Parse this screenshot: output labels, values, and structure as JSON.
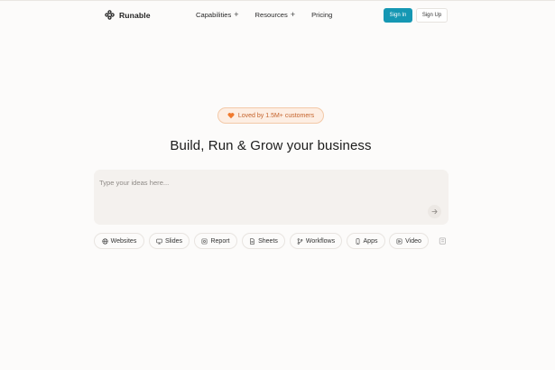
{
  "header": {
    "logo_text": "Runable",
    "nav": [
      {
        "label": "Capabilities",
        "icon": "plus-icon"
      },
      {
        "label": "Resources",
        "icon": "plus-icon"
      },
      {
        "label": "Pricing"
      }
    ],
    "sign_in_label": "Sign In",
    "sign_up_label": "Sign Up"
  },
  "hero": {
    "badge_text": "Loved by 1.5M+ customers",
    "badge_icon": "heart-icon",
    "title": "Build, Run & Grow your business"
  },
  "prompt": {
    "placeholder": "Type your ideas here...",
    "value": ""
  },
  "chips": [
    {
      "label": "Websites",
      "icon": "globe-icon"
    },
    {
      "label": "Slides",
      "icon": "monitor-icon"
    },
    {
      "label": "Report",
      "icon": "report-icon"
    },
    {
      "label": "Sheets",
      "icon": "sheet-icon"
    },
    {
      "label": "Workflows",
      "icon": "branch-icon"
    },
    {
      "label": "Apps",
      "icon": "phone-icon"
    },
    {
      "label": "Video",
      "icon": "video-icon"
    }
  ],
  "colors": {
    "accent": "#1597b3",
    "badge_bg": "#fdeee3",
    "badge_text": "#c4622a",
    "heart": "#f07a2e",
    "background": "#fcfbfa"
  }
}
